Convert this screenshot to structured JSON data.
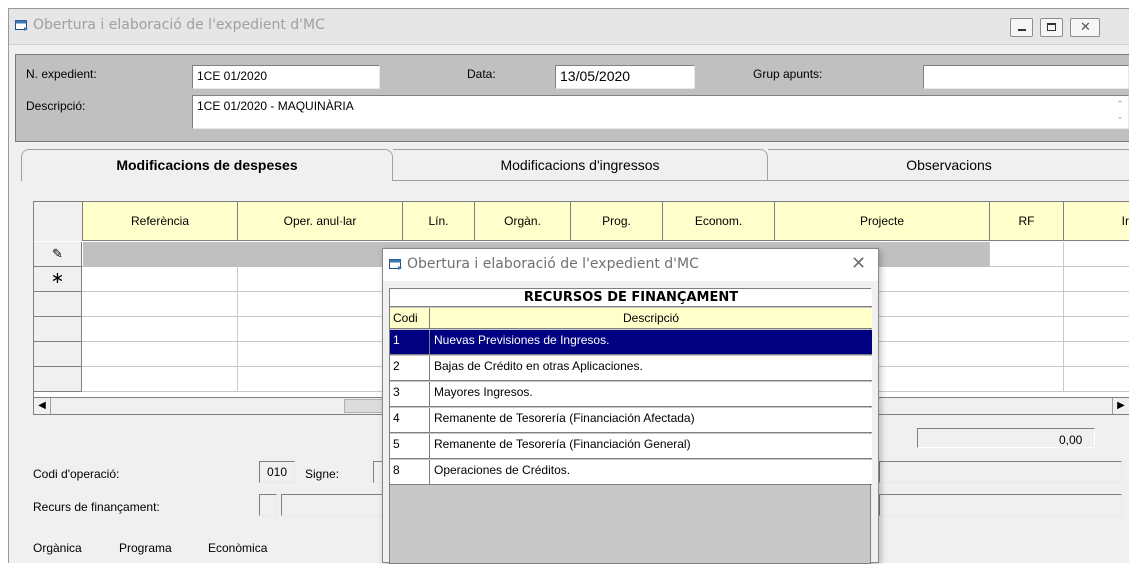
{
  "window": {
    "title": "Obertura i elaboració de l'expedient d'MC"
  },
  "header": {
    "expedient_label": "N. expedient:",
    "expedient_value": "1CE 01/2020",
    "data_label": "Data:",
    "data_value": "13/05/2020",
    "grup_label": "Grup apunts:",
    "grup_value": "",
    "descripcio_label": "Descripció:",
    "descripcio_value": "1CE 01/2020 - MAQUINÀRIA"
  },
  "tabs": [
    {
      "label": "Modificacions de despeses",
      "active": true
    },
    {
      "label": "Modificacions d'ingressos",
      "active": false
    },
    {
      "label": "Observacions",
      "active": false
    }
  ],
  "grid": {
    "columns": [
      "Referència",
      "Oper. anul·lar",
      "Lín.",
      "Orgàn.",
      "Prog.",
      "Econom.",
      "Projecte",
      "RF",
      "Ir"
    ],
    "row_markers": [
      "✎",
      "∗",
      "",
      "",
      "",
      ""
    ]
  },
  "bottom": {
    "total_value": "0,00",
    "codi_label": "Codi d'operació:",
    "codi_value": "010",
    "signe_label": "Signe:",
    "recurs_label": "Recurs de finançament:",
    "organica_label": "Orgànica",
    "programa_label": "Programa",
    "economica_label": "Econòmica"
  },
  "popup": {
    "title": "Obertura i elaboració de l'expedient d'MC",
    "heading": "RECURSOS DE FINANÇAMENT",
    "col_codi": "Codi",
    "col_descripcio": "Descripció",
    "items": [
      {
        "codi": "1",
        "descripcio": "Nuevas Previsiones de Ingresos.",
        "selected": true
      },
      {
        "codi": "2",
        "descripcio": "Bajas de Crédito en otras Aplicaciones.",
        "selected": false
      },
      {
        "codi": "3",
        "descripcio": "Mayores Ingresos.",
        "selected": false
      },
      {
        "codi": "4",
        "descripcio": "Remanente de Tesorería (Financiación Afectada)",
        "selected": false
      },
      {
        "codi": "5",
        "descripcio": "Remanente de Tesorería (Financiación General)",
        "selected": false
      },
      {
        "codi": "8",
        "descripcio": "Operaciones de Créditos.",
        "selected": false
      }
    ]
  },
  "colors": {
    "selection": "#000080",
    "grid_header": "#ffffcc",
    "panel": "#c0c0c0"
  }
}
